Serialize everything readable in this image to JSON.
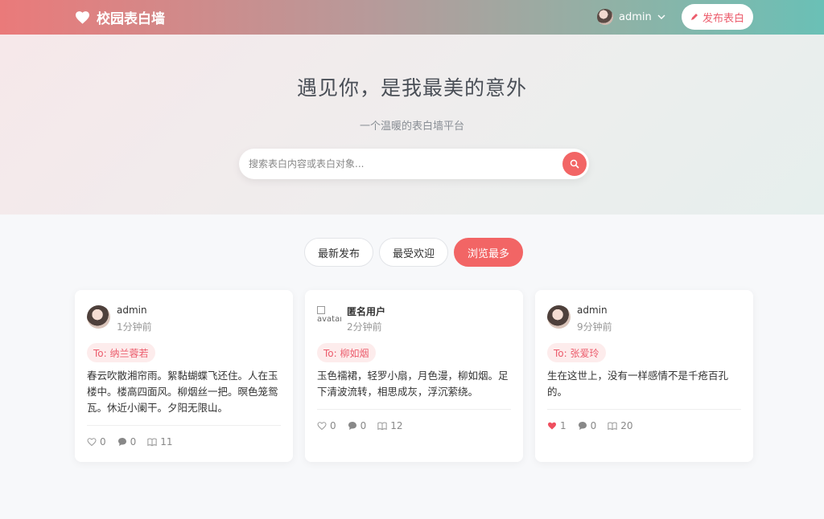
{
  "nav": {
    "brand": "校园表白墙",
    "user": "admin",
    "publish_label": "发布表白"
  },
  "hero": {
    "title": "遇见你，是我最美的意外",
    "subtitle": "一个温暖的表白墙平台",
    "search_placeholder": "搜索表白内容或表白对象..."
  },
  "filters": [
    {
      "label": "最新发布",
      "active": false
    },
    {
      "label": "最受欢迎",
      "active": false
    },
    {
      "label": "浏览最多",
      "active": true
    }
  ],
  "posts": [
    {
      "author": "admin",
      "time": "1分钟前",
      "to": "To: 纳兰蓉若",
      "content": "春云吹散湘帘雨。絮黏蝴蝶飞还住。人在玉楼中。楼高四面风。柳烟丝一把。暝色笼鸳瓦。休近小阑干。夕阳无限山。",
      "likes": "0",
      "comments": "0",
      "views": "11",
      "liked": false
    },
    {
      "author": "匿名用户",
      "avatar_alt": "avatar",
      "time": "2分钟前",
      "to": "To: 柳如烟",
      "content": "玉色襦裙，轻罗小扇，月色漫，柳如烟。足下清波流转，相思成灰，浮沉萦绕。",
      "likes": "0",
      "comments": "0",
      "views": "12",
      "liked": false
    },
    {
      "author": "admin",
      "time": "9分钟前",
      "to": "To: 张爱玲",
      "content": "生在这世上，没有一样感情不是千疮百孔的。",
      "likes": "1",
      "comments": "0",
      "views": "20",
      "liked": true
    }
  ],
  "colors": {
    "accent": "#f26565",
    "tag_bg": "#fdecec",
    "tag_text": "#ec5c6c"
  }
}
